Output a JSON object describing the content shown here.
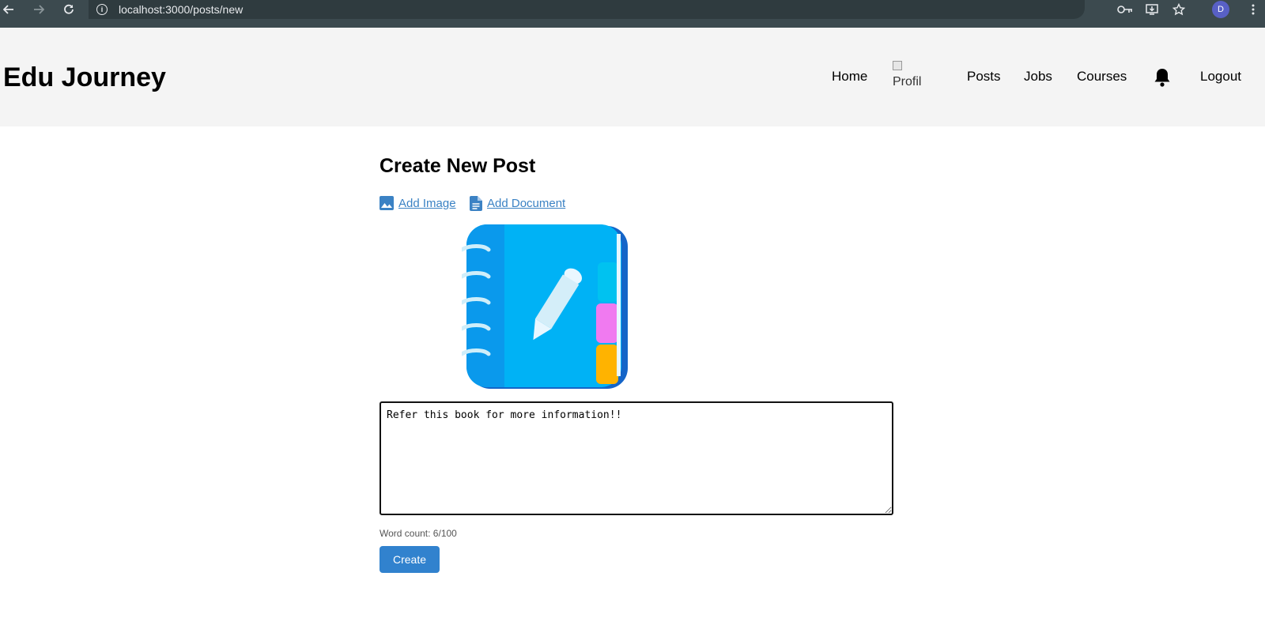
{
  "browser": {
    "url": "localhost:3000/posts/new",
    "profile_initial": "D"
  },
  "header": {
    "brand": "Edu Journey",
    "nav": {
      "home": "Home",
      "profile_alt": "Profil",
      "posts": "Posts",
      "jobs": "Jobs",
      "courses": "Courses",
      "logout": "Logout"
    }
  },
  "main": {
    "title": "Create New Post",
    "add_image_label": "Add Image",
    "add_document_label": "Add Document",
    "post_text": "Refer this book for more information!!",
    "word_count": "Word count: 6/100",
    "create_label": "Create"
  },
  "colors": {
    "accent": "#3182ce",
    "link": "#3b82c4",
    "header_bg": "#f4f4f4",
    "chrome_bg": "#3c4a4f"
  },
  "icons": {
    "back": "arrow-left-icon",
    "forward": "arrow-right-icon",
    "reload": "reload-icon",
    "site_info": "info-icon",
    "password": "key-icon",
    "install": "install-icon",
    "bookmark": "star-icon",
    "menu": "more-vertical-icon",
    "notifications": "bell-icon",
    "image": "image-icon",
    "document": "document-icon"
  }
}
